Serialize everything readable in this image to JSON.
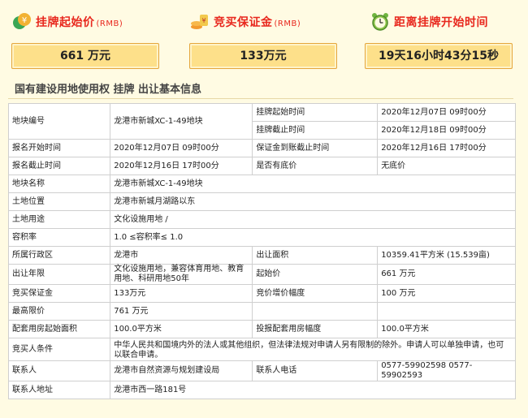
{
  "header": {
    "start_price": {
      "title": "挂牌起始价",
      "unit_tag": "(RMB)",
      "value": "661 万元",
      "icon": "money-icon"
    },
    "deposit": {
      "title": "竞买保证金",
      "unit_tag": "(RMB)",
      "value": "133万元",
      "icon": "coin-stack-icon"
    },
    "countdown": {
      "title": "距离挂牌开始时间",
      "value": "19天16小时43分15秒",
      "icon": "alarm-clock-icon"
    }
  },
  "section_title": "国有建设用地使用权 挂牌 出让基本信息",
  "table": {
    "parcel_no_label": "地块编号",
    "parcel_no": "龙港市新城XC-1-49地块",
    "list_start_label": "挂牌起始时间",
    "list_start": "2020年12月07日 09时00分",
    "list_end_label": "挂牌截止时间",
    "list_end": "2020年12月18日 09时00分",
    "reg_start_label": "报名开始时间",
    "reg_start": "2020年12月07日 09时00分",
    "deposit_deadline_label": "保证金到账截止时间",
    "deposit_deadline": "2020年12月16日 17时00分",
    "reg_end_label": "报名截止时间",
    "reg_end": "2020年12月16日 17时00分",
    "reserve_label": "是否有底价",
    "reserve": "无底价",
    "parcel_name_label": "地块名称",
    "parcel_name": "龙港市新城XC-1-49地块",
    "location_label": "土地位置",
    "location": "龙港市新城月湖路以东",
    "usage_label": "土地用途",
    "usage": "文化设施用地 /",
    "far_label": "容积率",
    "far": "1.0 ≤容积率≤ 1.0",
    "district_label": "所属行政区",
    "district": "龙港市",
    "area_label": "出让面积",
    "area": "10359.41平方米 (15.539亩)",
    "term_label": "出让年限",
    "term": "文化设施用地，兼容体育用地、教育用地、科研用地50年",
    "start_price_label": "起始价",
    "start_price": "661 万元",
    "bid_deposit_label": "竞买保证金",
    "bid_deposit": "133万元",
    "increment_label": "竞价增价幅度",
    "increment": "100 万元",
    "max_price_label": "最高限价",
    "max_price": "761 万元",
    "housing_start_label": "配套用房起始面积",
    "housing_start": "100.0平方米",
    "housing_incr_label": "投报配套用房幅度",
    "housing_incr": "100.0平方米",
    "bidder_cond_label": "竞买人条件",
    "bidder_cond": "中华人民共和国境内外的法人或其他组织，但法律法规对申请人另有限制的除外。申请人可以单独申请，也可以联合申请。",
    "contact_label": "联系人",
    "contact": "龙港市自然资源与规划建设局",
    "phone_label": "联系人电话",
    "phone": "0577-59902598 0577-59902593",
    "address_label": "联系人地址",
    "address": "龙港市西一路181号"
  }
}
